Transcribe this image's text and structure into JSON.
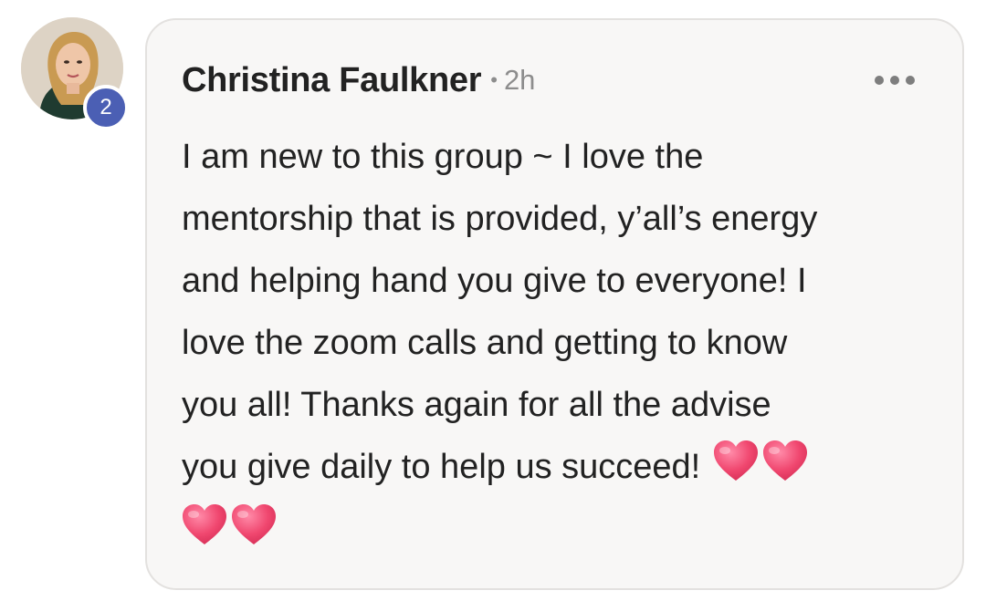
{
  "comment": {
    "author": "Christina Faulkner",
    "separator": "•",
    "timestamp": "2h",
    "avatar_badge": "2",
    "more_icon": "more-horizontal-icon",
    "lines": [
      "I am new to this group ~ I love the",
      "mentorship that is provided, y’all’s energy",
      "and helping hand you give to everyone! I",
      "love the zoom calls and getting to know",
      "you all! Thanks again for all the advise",
      "you give daily to help us succeed!"
    ],
    "emoji": [
      "heart-icon",
      "heart-icon",
      "heart-icon",
      "heart-icon"
    ],
    "colors": {
      "badge": "#4b5fb4",
      "card_bg": "#f8f7f6",
      "heart": "#f0476f"
    }
  }
}
